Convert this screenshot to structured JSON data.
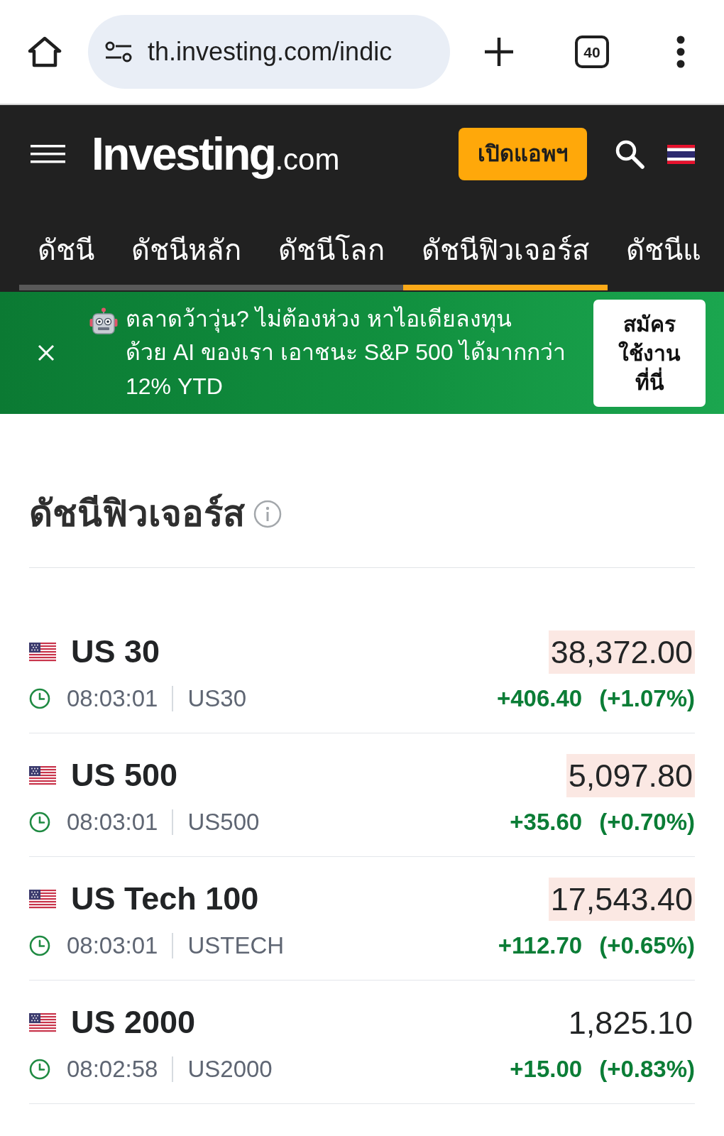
{
  "browser": {
    "url": "th.investing.com/indic",
    "tab_count": "40"
  },
  "site_header": {
    "logo": "Investing",
    "logo_suffix": ".com",
    "app_button": "เปิดแอพฯ"
  },
  "nav_tabs": [
    {
      "label": "ดัชนี",
      "selected": false
    },
    {
      "label": "ดัชนีหลัก",
      "selected": false
    },
    {
      "label": "ดัชนีโลก",
      "selected": false
    },
    {
      "label": "ดัชนีฟิวเจอร์ส",
      "selected": true
    },
    {
      "label": "ดัชนีแ",
      "selected": false
    }
  ],
  "promo_banner": {
    "lines": [
      "ตลาดว้าวุ่น? ไม่ต้องห่วง หาไอเดียลงทุน",
      "ด้วย AI ของเรา เอาชนะ S&P 500 ได้มากกว่า",
      "12% YTD"
    ],
    "button_lines": [
      "สมัคร",
      "ใช้งาน",
      "ที่นี่"
    ]
  },
  "futures": {
    "title": "ดัชนีฟิวเจอร์ส",
    "rows": [
      {
        "name": "US 30",
        "price": "38,372.00",
        "highlighted": true,
        "time": "08:03:01",
        "symbol": "US30",
        "change": "+406.40",
        "change_percent": "(+1.07%)"
      },
      {
        "name": "US 500",
        "price": "5,097.80",
        "highlighted": true,
        "time": "08:03:01",
        "symbol": "US500",
        "change": "+35.60",
        "change_percent": "(+0.70%)"
      },
      {
        "name": "US Tech 100",
        "price": "17,543.40",
        "highlighted": true,
        "time": "08:03:01",
        "symbol": "USTECH",
        "change": "+112.70",
        "change_percent": "(+0.65%)"
      },
      {
        "name": "US 2000",
        "price": "1,825.10",
        "highlighted": false,
        "time": "08:02:58",
        "symbol": "US2000",
        "change": "+15.00",
        "change_percent": "(+0.83%)"
      }
    ]
  }
}
